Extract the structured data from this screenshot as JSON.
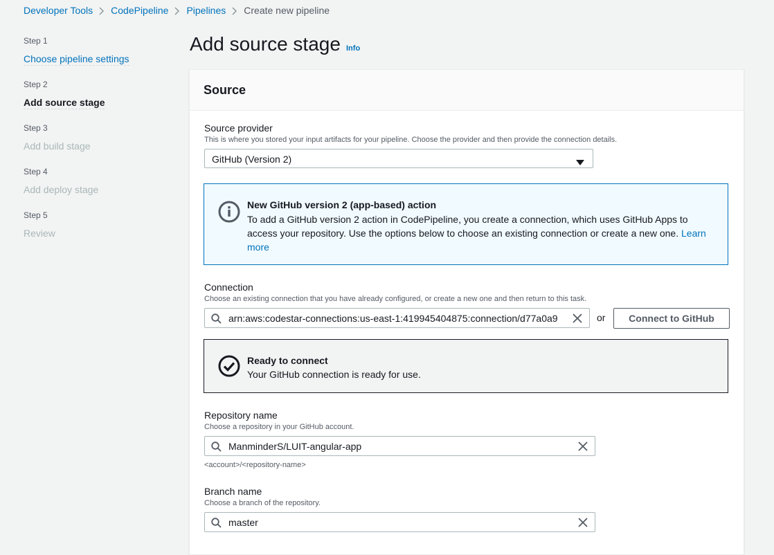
{
  "breadcrumb": [
    "Developer Tools",
    "CodePipeline",
    "Pipelines",
    "Create new pipeline"
  ],
  "steps": [
    {
      "label": "Step 1",
      "name": "Choose pipeline settings"
    },
    {
      "label": "Step 2",
      "name": "Add source stage"
    },
    {
      "label": "Step 3",
      "name": "Add build stage"
    },
    {
      "label": "Step 4",
      "name": "Add deploy stage"
    },
    {
      "label": "Step 5",
      "name": "Review"
    }
  ],
  "page": {
    "title": "Add source stage",
    "info": "Info"
  },
  "panel": {
    "title": "Source"
  },
  "source_provider": {
    "label": "Source provider",
    "description": "This is where you stored your input artifacts for your pipeline. Choose the provider and then provide the connection details.",
    "value": "GitHub (Version 2)"
  },
  "info_alert": {
    "title": "New GitHub version 2 (app-based) action",
    "body": "To add a GitHub version 2 action in CodePipeline, you create a connection, which uses GitHub Apps to access your repository. Use the options below to choose an existing connection or create a new one.",
    "link": "Learn more"
  },
  "connection": {
    "label": "Connection",
    "description": "Choose an existing connection that you have already configured, or create a new one and then return to this task.",
    "value": "arn:aws:codestar-connections:us-east-1:419945404875:connection/d77a0a9",
    "or": "or",
    "button": "Connect to GitHub"
  },
  "success_alert": {
    "title": "Ready to connect",
    "body": "Your GitHub connection is ready for use."
  },
  "repository": {
    "label": "Repository name",
    "description": "Choose a repository in your GitHub account.",
    "value": "ManminderS/LUIT-angular-app",
    "constraint": "<account>/<repository-name>"
  },
  "branch": {
    "label": "Branch name",
    "description": "Choose a branch of the repository.",
    "value": "master"
  },
  "colors": {
    "link": "#0073bb",
    "info_border": "#0073bb",
    "info_bg": "#f1faff",
    "page_bg": "#f2f3f3"
  }
}
